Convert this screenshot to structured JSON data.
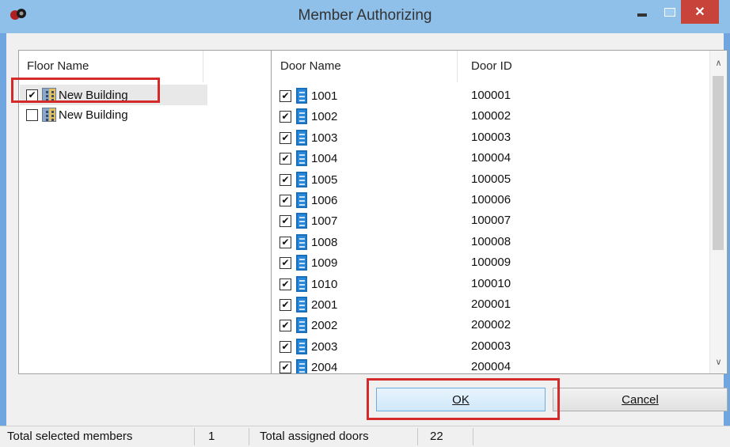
{
  "window": {
    "title": "Member Authorizing",
    "close_glyph": "✕"
  },
  "floor_list": {
    "header": "Floor Name",
    "items": [
      {
        "label": "New Building",
        "checked": true
      },
      {
        "label": "New Building",
        "checked": false
      }
    ]
  },
  "door_list": {
    "header_name": "Door Name",
    "header_id": "Door ID",
    "rows": [
      {
        "name": "1001",
        "id": "100001"
      },
      {
        "name": "1002",
        "id": "100002"
      },
      {
        "name": "1003",
        "id": "100003"
      },
      {
        "name": "1004",
        "id": "100004"
      },
      {
        "name": "1005",
        "id": "100005"
      },
      {
        "name": "1006",
        "id": "100006"
      },
      {
        "name": "1007",
        "id": "100007"
      },
      {
        "name": "1008",
        "id": "100008"
      },
      {
        "name": "1009",
        "id": "100009"
      },
      {
        "name": "1010",
        "id": "100010"
      },
      {
        "name": "2001",
        "id": "200001"
      },
      {
        "name": "2002",
        "id": "200002"
      },
      {
        "name": "2003",
        "id": "200003"
      },
      {
        "name": "2004",
        "id": "200004"
      }
    ]
  },
  "buttons": {
    "ok_label": "OK",
    "cancel_label": "Cancel"
  },
  "status_bar": {
    "selected_members_label": "Total selected members",
    "selected_members_value": "1",
    "assigned_doors_label": "Total assigned doors",
    "assigned_doors_value": "22"
  },
  "check_glyph": "✔",
  "colors": {
    "highlight": "#d42a2a",
    "title_bar": "#8ec0ea",
    "close_button": "#c8443a"
  }
}
